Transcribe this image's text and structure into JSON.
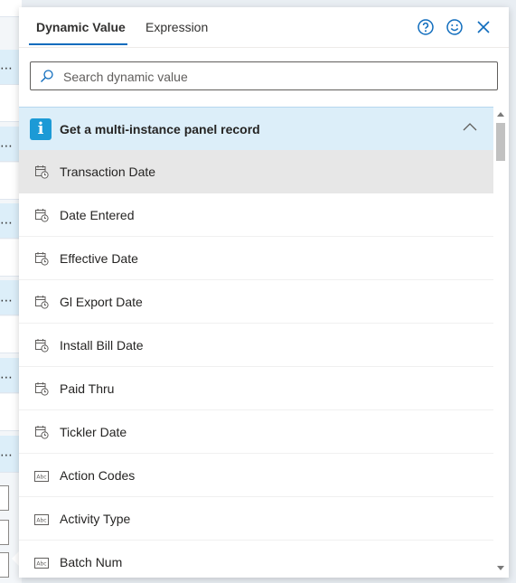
{
  "background": {
    "ellipsis": "⋯"
  },
  "tabs": [
    {
      "label": "Dynamic Value",
      "active": true
    },
    {
      "label": "Expression",
      "active": false
    }
  ],
  "header_icons": [
    "help-icon",
    "feedback-smiley-icon",
    "close-icon"
  ],
  "search": {
    "placeholder": "Search dynamic value",
    "value": ""
  },
  "group": {
    "badge": "i",
    "title": "Get a multi-instance panel record",
    "expanded": true
  },
  "items": [
    {
      "label": "Transaction Date",
      "icon": "date-icon",
      "selected": true
    },
    {
      "label": "Date Entered",
      "icon": "date-icon",
      "selected": false
    },
    {
      "label": "Effective Date",
      "icon": "date-icon",
      "selected": false
    },
    {
      "label": "Gl Export Date",
      "icon": "date-icon",
      "selected": false
    },
    {
      "label": "Install Bill Date",
      "icon": "date-icon",
      "selected": false
    },
    {
      "label": "Paid Thru",
      "icon": "date-icon",
      "selected": false
    },
    {
      "label": "Tickler Date",
      "icon": "date-icon",
      "selected": false
    },
    {
      "label": "Action Codes",
      "icon": "text-icon",
      "selected": false
    },
    {
      "label": "Activity Type",
      "icon": "text-icon",
      "selected": false
    },
    {
      "label": "Batch Num",
      "icon": "text-icon",
      "selected": false
    }
  ],
  "colors": {
    "accent": "#0f6cbd",
    "group_bg": "#dceef9",
    "info_badge": "#1c9ad6",
    "selected_row": "#e7e7e7"
  }
}
